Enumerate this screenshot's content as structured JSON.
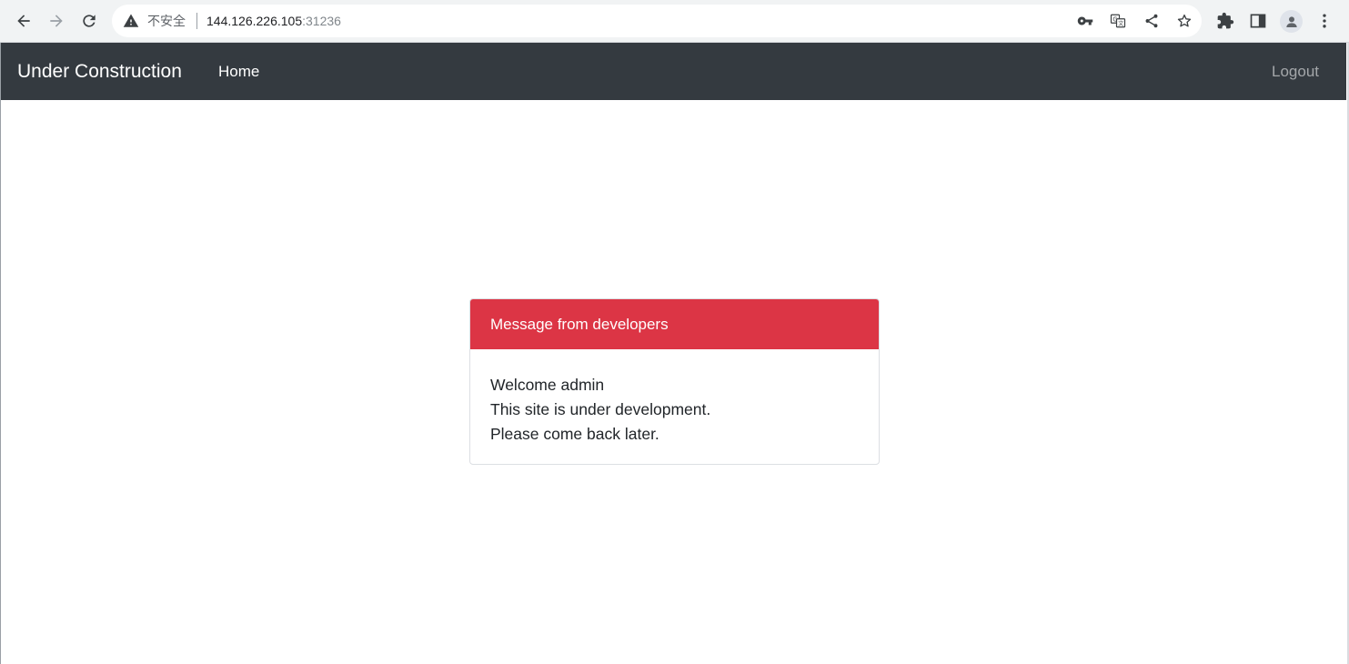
{
  "browser": {
    "security_label": "不安全",
    "url_host": "144.126.226.105",
    "url_port": ":31236",
    "icons": {
      "back": "back-arrow-icon",
      "forward": "forward-arrow-icon",
      "reload": "reload-icon",
      "warning": "warning-icon",
      "key": "key-icon",
      "translate": "translate-icon",
      "share": "share-icon",
      "bookmark": "star-icon",
      "extensions": "puzzle-icon",
      "side_panel": "side-panel-icon",
      "profile": "profile-icon",
      "menu": "kebab-menu-icon"
    }
  },
  "navbar": {
    "brand": "Under Construction",
    "home_label": "Home",
    "logout_label": "Logout",
    "background": "#343a40"
  },
  "card": {
    "header": "Message from developers",
    "header_color": "#dc3545",
    "lines": [
      "Welcome admin",
      "This site is under development.",
      "Please come back later."
    ]
  }
}
